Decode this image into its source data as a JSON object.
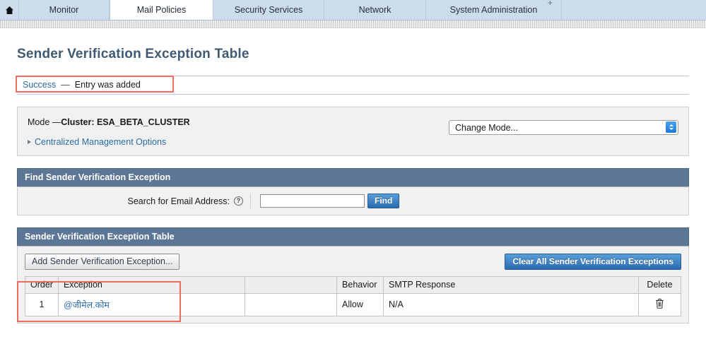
{
  "navbar": {
    "home_icon": "home-icon",
    "plus_glyph": "+",
    "tabs": [
      {
        "label": "Monitor",
        "active": false
      },
      {
        "label": "Mail Policies",
        "active": true
      },
      {
        "label": "Security Services",
        "active": false
      },
      {
        "label": "Network",
        "active": false
      },
      {
        "label": "System Administration",
        "active": false
      }
    ]
  },
  "page": {
    "title": "Sender Verification Exception Table"
  },
  "message": {
    "status": "Success",
    "dash": "—",
    "text": "Entry was added"
  },
  "mode": {
    "label_prefix": "Mode —",
    "label_cluster": "Cluster:",
    "cluster_name": "ESA_BETA_CLUSTER",
    "centralized_link": "Centralized Management Options",
    "change_mode_value": "Change Mode..."
  },
  "find_section": {
    "heading": "Find Sender Verification Exception",
    "search_label": "Search for Email Address:",
    "help_glyph": "?",
    "search_value": "",
    "search_placeholder": "",
    "find_button": "Find"
  },
  "table_section": {
    "heading": "Sender Verification Exception Table",
    "add_button": "Add Sender Verification Exception...",
    "clear_button": "Clear All Sender Verification Exceptions",
    "columns": {
      "order": "Order",
      "exception": "Exception",
      "spacer": "",
      "behavior": "Behavior",
      "smtp_response": "SMTP Response",
      "delete": "Delete"
    },
    "rows": [
      {
        "order": "1",
        "exception": "@जीमेल.कोम",
        "spacer": "",
        "behavior": "Allow",
        "smtp_response": "N/A",
        "delete_icon": "trash-icon"
      }
    ]
  },
  "colors": {
    "nav_bg": "#cddcec",
    "panel_header": "#5c7695",
    "link": "#2b6ca3",
    "title": "#3f5a72",
    "annotation_red": "#f26b5e",
    "button_blue": "#2a6ab0"
  }
}
